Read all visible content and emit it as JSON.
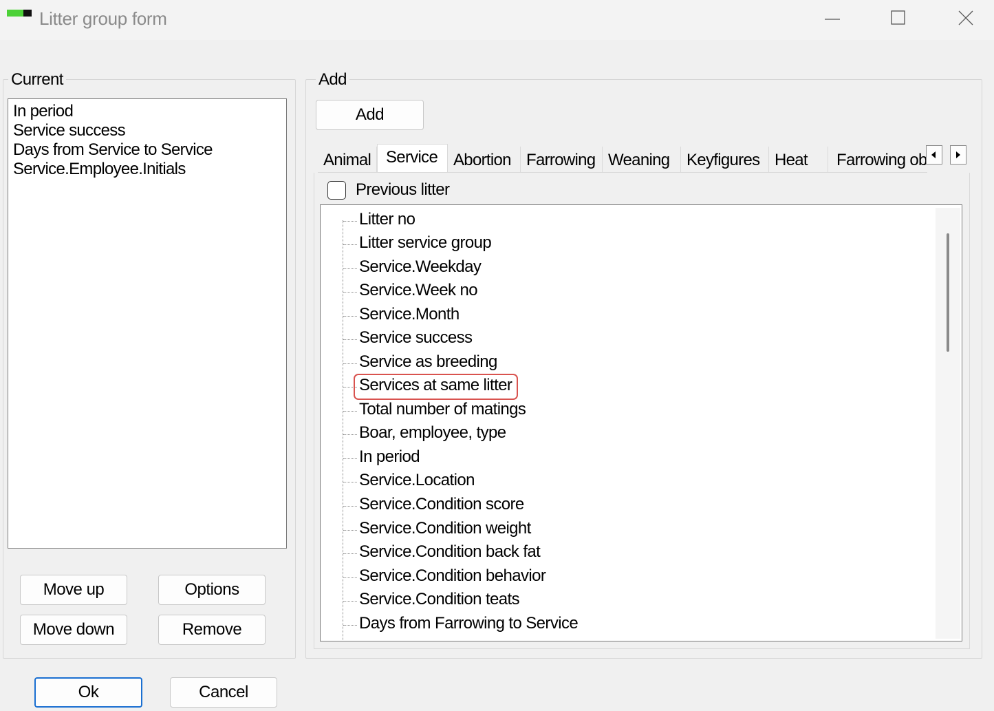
{
  "window": {
    "title": "Litter group form"
  },
  "current_group": {
    "label": "Current",
    "items": [
      "In period",
      "Service success",
      "Days from Service  to Service",
      "Service.Employee.Initials"
    ],
    "buttons": {
      "move_up": "Move up",
      "options": "Options",
      "move_down": "Move down",
      "remove": "Remove"
    }
  },
  "add_group": {
    "label": "Add",
    "add_button": "Add",
    "tabs": [
      "Animal",
      "Service",
      "Abortion",
      "Farrowing",
      "Weaning",
      "Keyfigures",
      "Heat",
      "Farrowing ob"
    ],
    "active_tab": "Service",
    "previous_litter_label": "Previous litter",
    "previous_litter_checked": false,
    "tree_items": [
      "Litter no",
      "Litter service group",
      "Service.Weekday",
      "Service.Week no",
      "Service.Month",
      "Service success",
      "Service as breeding",
      "Services at same litter",
      "Total number of matings",
      "Boar, employee, type",
      "In period",
      "Service.Location",
      "Service.Condition score",
      "Service.Condition weight",
      "Service.Condition back fat",
      "Service.Condition behavior",
      "Service.Condition teats",
      "Days from Farrowing  to Service"
    ],
    "highlighted_item": "Services at same litter"
  },
  "dialog_buttons": {
    "ok": "Ok",
    "cancel": "Cancel"
  }
}
